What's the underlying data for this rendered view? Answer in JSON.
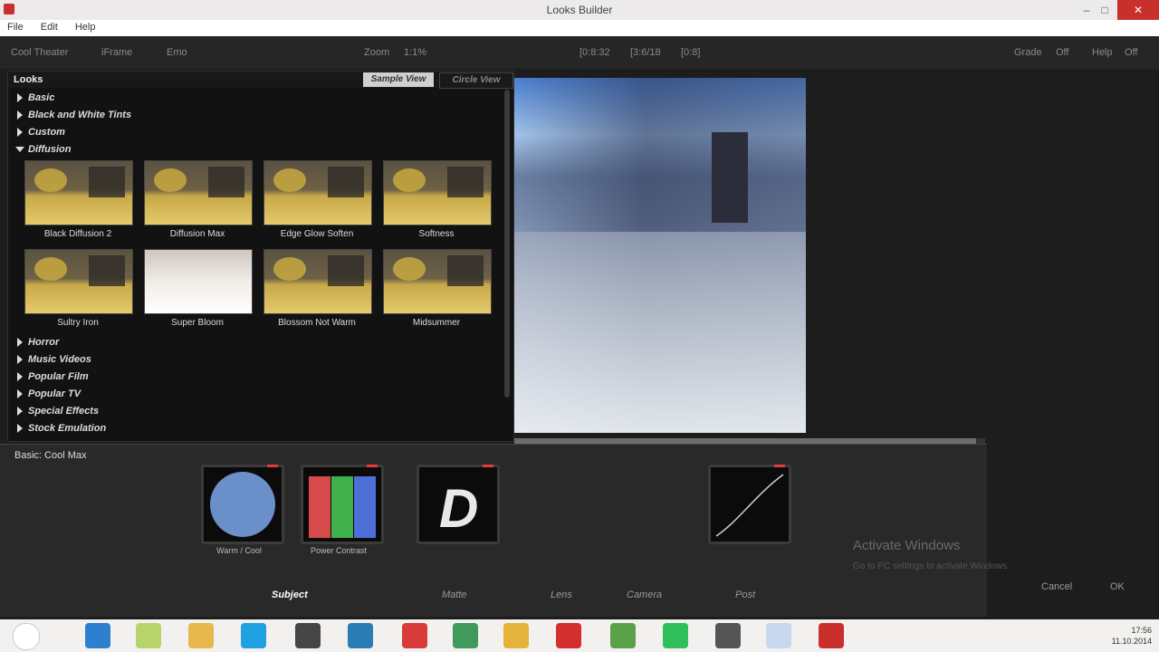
{
  "window": {
    "title": "Looks Builder"
  },
  "menu": [
    "File",
    "Edit",
    "Help"
  ],
  "toolbar": {
    "left": [
      "Cool Theater",
      "iFrame",
      "Emo"
    ],
    "zoom_label": "Zoom",
    "zoom_value": "1:1%",
    "center": [
      "[0:8:32",
      "[3:6/18",
      "[0:8]"
    ],
    "right": [
      "Grade",
      "Off",
      "Help",
      "Off"
    ]
  },
  "looks": {
    "header": "Looks",
    "tabs": [
      "Sample View",
      "Circle View"
    ],
    "categories_top": [
      "Basic",
      "Black and White Tints",
      "Custom",
      "Diffusion"
    ],
    "thumbnails": [
      "Black Diffusion 2",
      "Diffusion Max",
      "Edge Glow Soften",
      "Softness",
      "Sultry Iron",
      "Super Bloom",
      "Blossom Not Warm",
      "Midsummer"
    ],
    "categories_bottom": [
      "Horror",
      "Music Videos",
      "Popular Film",
      "Popular TV",
      "Special Effects",
      "Stock Emulation"
    ]
  },
  "bottom": {
    "look_name": "Basic: Cool Max",
    "tools": [
      {
        "label": "Warm / Cool"
      },
      {
        "label": "Power Contrast"
      },
      {
        "label": ""
      },
      {
        "label": ""
      }
    ],
    "stages": [
      "Subject",
      "Matte",
      "Lens",
      "Camera",
      "Post"
    ],
    "activate_title": "Activate Windows",
    "activate_sub": "Go to PC settings to activate Windows.",
    "buttons": [
      "Cancel",
      "OK"
    ]
  },
  "tray": {
    "time": "17:56",
    "date": "11.10.2014"
  },
  "progress": 0.98
}
